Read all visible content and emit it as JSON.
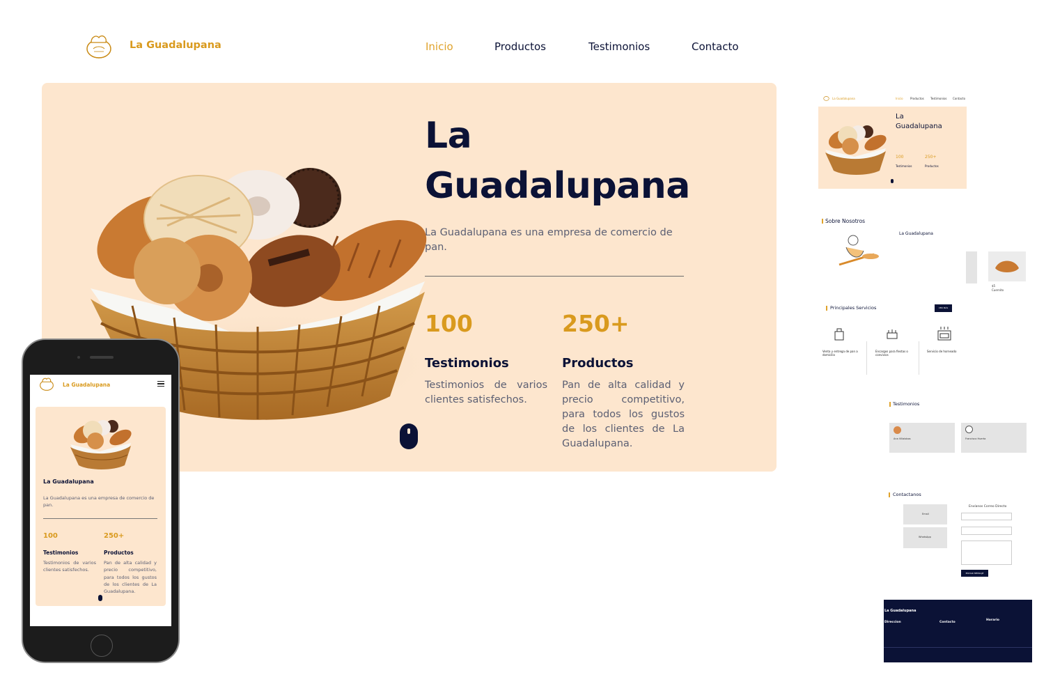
{
  "brand": {
    "name": "La Guadalupana",
    "logo_icon": "bakery-logo-icon"
  },
  "nav": {
    "items": [
      "Inicio",
      "Productos",
      "Testimonios",
      "Contacto"
    ],
    "active_index": 0
  },
  "hero": {
    "title_line1": "La",
    "title_line2": "Guadalupana",
    "description": "La Guadalupana es una empresa de comercio de pan.",
    "image_icon": "bread-basket-image",
    "stats": [
      {
        "number": "100",
        "title": "Testimonios",
        "text": "Testimonios de varios clientes satisfechos."
      },
      {
        "number": "250+",
        "title": "Productos",
        "text": "Pan de alta calidad y precio competitivo, para todos los gustos de los clientes de La Guadalupana."
      }
    ],
    "scroll_icon": "mouse-scroll-icon"
  },
  "mobile": {
    "brand": "La Guadalupana",
    "title": "La Guadalupana",
    "description": "La Guadalupana es una empresa de comercio de pan.",
    "menu_icon": "hamburger-menu-icon"
  },
  "thumbnail": {
    "sobre": "Sobre Nosotros",
    "sobre_title": "La Guadalupana",
    "servicios": "Principales Servicios",
    "servicios_button": "VER MÁS",
    "services": [
      "Venta y entrega de pan a domicilio",
      "Encargos para fiestas o convivios",
      "Servicio de horneado"
    ],
    "testimonios": "Testimonios",
    "testimonial_names": [
      "Ana Villalobos",
      "Francisco Huerta"
    ],
    "contacto": "Contactanos",
    "contact_form_title": "Envíanos Correo Directo",
    "contact_cards": [
      "Email",
      "WhatsApp"
    ],
    "send_button": "ENVIAR MENSAJE",
    "product_price": "$5",
    "product_name": "Cuernito",
    "footer_brand": "La Guadalupana",
    "footer_cols": [
      "Direccion",
      "Contacto",
      "Horario"
    ]
  },
  "colors": {
    "accent": "#d99a1e",
    "hero_bg": "#fde6ce",
    "dark": "#0b1236"
  }
}
